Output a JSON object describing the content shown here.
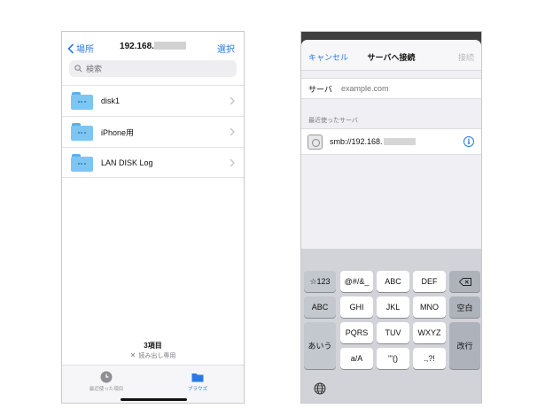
{
  "files_screen": {
    "nav": {
      "back_label": "場所",
      "title_prefix": "192.168.",
      "select_label": "選択"
    },
    "search": {
      "placeholder": "検索"
    },
    "items": [
      {
        "name": "disk1"
      },
      {
        "name": "iPhone用"
      },
      {
        "name": "LAN DISK Log"
      }
    ],
    "footer": {
      "count": "3項目",
      "readonly": "読み出し専用"
    },
    "tabs": [
      {
        "label": "最近使った項目",
        "icon": "clock-icon",
        "active": false
      },
      {
        "label": "ブラウズ",
        "icon": "folder-icon",
        "active": true
      }
    ]
  },
  "connect_screen": {
    "nav": {
      "cancel_label": "キャンセル",
      "title": "サーバへ接続",
      "connect_label": "接続"
    },
    "server_field": {
      "label": "サーバ",
      "placeholder": "example.com"
    },
    "recent": {
      "header": "最近使ったサーバ",
      "url_prefix": "smb://192.168."
    }
  },
  "keyboard": {
    "row1": [
      "☆123",
      "@#/&_",
      "ABC",
      "DEF",
      "⌫"
    ],
    "row2": [
      "ABC",
      "GHI",
      "JKL",
      "MNO",
      "空白"
    ],
    "row3": [
      "あいう",
      "PQRS",
      "TUV",
      "WXYZ",
      "改行"
    ],
    "row4": [
      "a/A",
      "'\"()",
      ".,?!"
    ]
  },
  "colors": {
    "accent": "#2a7ae2",
    "folder": "#7ec6f2",
    "keyboard_bg": "#d1d3d9"
  }
}
